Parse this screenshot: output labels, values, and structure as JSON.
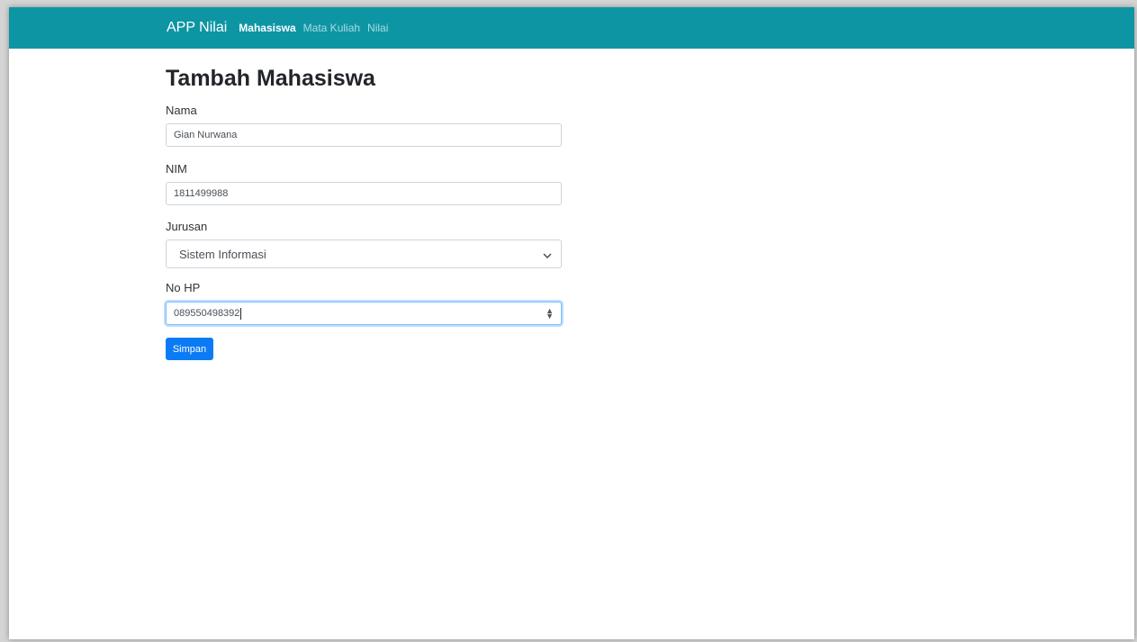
{
  "navbar": {
    "brand": "APP Nilai",
    "links": [
      {
        "label": "Mahasiswa",
        "active": true
      },
      {
        "label": "Mata Kuliah",
        "active": false
      },
      {
        "label": "Nilai",
        "active": false
      }
    ],
    "color": "#0e95a4"
  },
  "page": {
    "title": "Tambah Mahasiswa"
  },
  "form": {
    "nama": {
      "label": "Nama",
      "value": "Gian Nurwana"
    },
    "nim": {
      "label": "NIM",
      "value": "1811499988"
    },
    "jurusan": {
      "label": "Jurusan",
      "selected": "Sistem Informasi"
    },
    "no_hp": {
      "label": "No HP",
      "value": "089550498392"
    },
    "submit_label": "Simpan"
  },
  "colors": {
    "primary_button": "#0a7bf5",
    "focus_border": "#80bdff"
  },
  "icons": {
    "select_arrow": "chevron-down-icon",
    "number_spinner": "spinner-arrows-icon"
  }
}
